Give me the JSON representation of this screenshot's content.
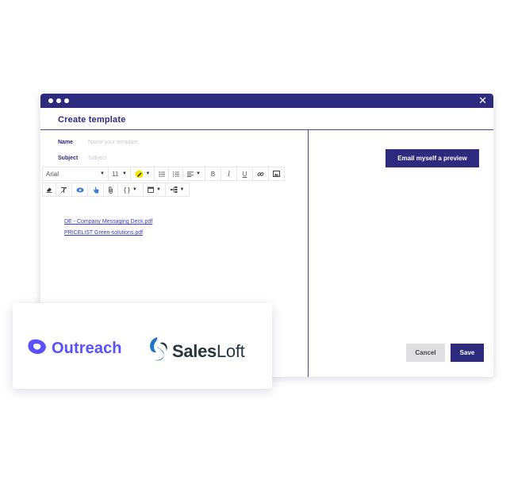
{
  "window": {
    "title": "Create template",
    "close_glyph": "✕"
  },
  "form": {
    "name_label": "Name",
    "name_placeholder": "Name your template",
    "subject_label": "Subject",
    "subject_placeholder": "Subject"
  },
  "toolbar": {
    "font_family": "Arial",
    "font_size": "11",
    "icons": [
      "highlighter-icon",
      "bullet-list-icon",
      "numbered-list-icon",
      "align-icon",
      "bold-icon",
      "italic-icon",
      "underline-icon",
      "link-icon",
      "image-icon",
      "eraser-icon",
      "clear-format-icon",
      "eye-icon",
      "hand-icon",
      "paperclip-icon",
      "braces-icon",
      "calendar-icon",
      "sitemap-icon"
    ],
    "bold_glyph": "B",
    "italic_glyph": "I",
    "underline_glyph": "U",
    "braces_glyph": "{ }"
  },
  "attachments": [
    "DE - Company Messaging Deck.pdf",
    "PRICELIST Green-solutions.pdf"
  ],
  "actions": {
    "preview_label": "Email myself a preview",
    "cancel_label": "Cancel",
    "save_label": "Save"
  },
  "logos": {
    "outreach": "Outreach",
    "salesloft_bold": "Sales",
    "salesloft_rest": "Loft"
  },
  "colors": {
    "brand": "#2e2a7e",
    "outreach": "#5951ff",
    "salesloft_blue": "#1e73c8",
    "link": "#3b3bcf"
  }
}
